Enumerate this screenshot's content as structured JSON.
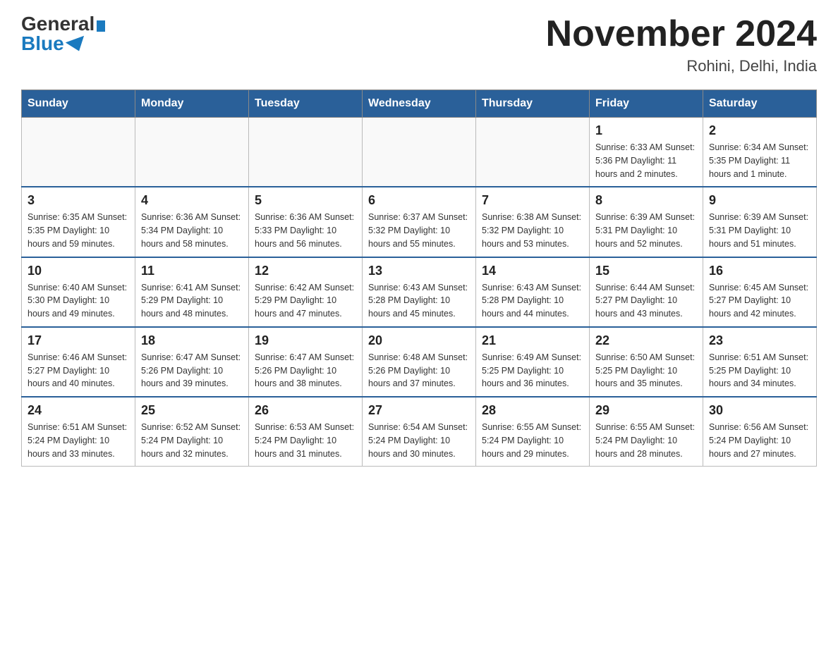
{
  "header": {
    "logo_general": "General",
    "logo_blue": "Blue",
    "month_title": "November 2024",
    "location": "Rohini, Delhi, India"
  },
  "weekdays": [
    "Sunday",
    "Monday",
    "Tuesday",
    "Wednesday",
    "Thursday",
    "Friday",
    "Saturday"
  ],
  "rows": [
    [
      {
        "day": "",
        "info": ""
      },
      {
        "day": "",
        "info": ""
      },
      {
        "day": "",
        "info": ""
      },
      {
        "day": "",
        "info": ""
      },
      {
        "day": "",
        "info": ""
      },
      {
        "day": "1",
        "info": "Sunrise: 6:33 AM\nSunset: 5:36 PM\nDaylight: 11 hours and 2 minutes."
      },
      {
        "day": "2",
        "info": "Sunrise: 6:34 AM\nSunset: 5:35 PM\nDaylight: 11 hours and 1 minute."
      }
    ],
    [
      {
        "day": "3",
        "info": "Sunrise: 6:35 AM\nSunset: 5:35 PM\nDaylight: 10 hours and 59 minutes."
      },
      {
        "day": "4",
        "info": "Sunrise: 6:36 AM\nSunset: 5:34 PM\nDaylight: 10 hours and 58 minutes."
      },
      {
        "day": "5",
        "info": "Sunrise: 6:36 AM\nSunset: 5:33 PM\nDaylight: 10 hours and 56 minutes."
      },
      {
        "day": "6",
        "info": "Sunrise: 6:37 AM\nSunset: 5:32 PM\nDaylight: 10 hours and 55 minutes."
      },
      {
        "day": "7",
        "info": "Sunrise: 6:38 AM\nSunset: 5:32 PM\nDaylight: 10 hours and 53 minutes."
      },
      {
        "day": "8",
        "info": "Sunrise: 6:39 AM\nSunset: 5:31 PM\nDaylight: 10 hours and 52 minutes."
      },
      {
        "day": "9",
        "info": "Sunrise: 6:39 AM\nSunset: 5:31 PM\nDaylight: 10 hours and 51 minutes."
      }
    ],
    [
      {
        "day": "10",
        "info": "Sunrise: 6:40 AM\nSunset: 5:30 PM\nDaylight: 10 hours and 49 minutes."
      },
      {
        "day": "11",
        "info": "Sunrise: 6:41 AM\nSunset: 5:29 PM\nDaylight: 10 hours and 48 minutes."
      },
      {
        "day": "12",
        "info": "Sunrise: 6:42 AM\nSunset: 5:29 PM\nDaylight: 10 hours and 47 minutes."
      },
      {
        "day": "13",
        "info": "Sunrise: 6:43 AM\nSunset: 5:28 PM\nDaylight: 10 hours and 45 minutes."
      },
      {
        "day": "14",
        "info": "Sunrise: 6:43 AM\nSunset: 5:28 PM\nDaylight: 10 hours and 44 minutes."
      },
      {
        "day": "15",
        "info": "Sunrise: 6:44 AM\nSunset: 5:27 PM\nDaylight: 10 hours and 43 minutes."
      },
      {
        "day": "16",
        "info": "Sunrise: 6:45 AM\nSunset: 5:27 PM\nDaylight: 10 hours and 42 minutes."
      }
    ],
    [
      {
        "day": "17",
        "info": "Sunrise: 6:46 AM\nSunset: 5:27 PM\nDaylight: 10 hours and 40 minutes."
      },
      {
        "day": "18",
        "info": "Sunrise: 6:47 AM\nSunset: 5:26 PM\nDaylight: 10 hours and 39 minutes."
      },
      {
        "day": "19",
        "info": "Sunrise: 6:47 AM\nSunset: 5:26 PM\nDaylight: 10 hours and 38 minutes."
      },
      {
        "day": "20",
        "info": "Sunrise: 6:48 AM\nSunset: 5:26 PM\nDaylight: 10 hours and 37 minutes."
      },
      {
        "day": "21",
        "info": "Sunrise: 6:49 AM\nSunset: 5:25 PM\nDaylight: 10 hours and 36 minutes."
      },
      {
        "day": "22",
        "info": "Sunrise: 6:50 AM\nSunset: 5:25 PM\nDaylight: 10 hours and 35 minutes."
      },
      {
        "day": "23",
        "info": "Sunrise: 6:51 AM\nSunset: 5:25 PM\nDaylight: 10 hours and 34 minutes."
      }
    ],
    [
      {
        "day": "24",
        "info": "Sunrise: 6:51 AM\nSunset: 5:24 PM\nDaylight: 10 hours and 33 minutes."
      },
      {
        "day": "25",
        "info": "Sunrise: 6:52 AM\nSunset: 5:24 PM\nDaylight: 10 hours and 32 minutes."
      },
      {
        "day": "26",
        "info": "Sunrise: 6:53 AM\nSunset: 5:24 PM\nDaylight: 10 hours and 31 minutes."
      },
      {
        "day": "27",
        "info": "Sunrise: 6:54 AM\nSunset: 5:24 PM\nDaylight: 10 hours and 30 minutes."
      },
      {
        "day": "28",
        "info": "Sunrise: 6:55 AM\nSunset: 5:24 PM\nDaylight: 10 hours and 29 minutes."
      },
      {
        "day": "29",
        "info": "Sunrise: 6:55 AM\nSunset: 5:24 PM\nDaylight: 10 hours and 28 minutes."
      },
      {
        "day": "30",
        "info": "Sunrise: 6:56 AM\nSunset: 5:24 PM\nDaylight: 10 hours and 27 minutes."
      }
    ]
  ]
}
